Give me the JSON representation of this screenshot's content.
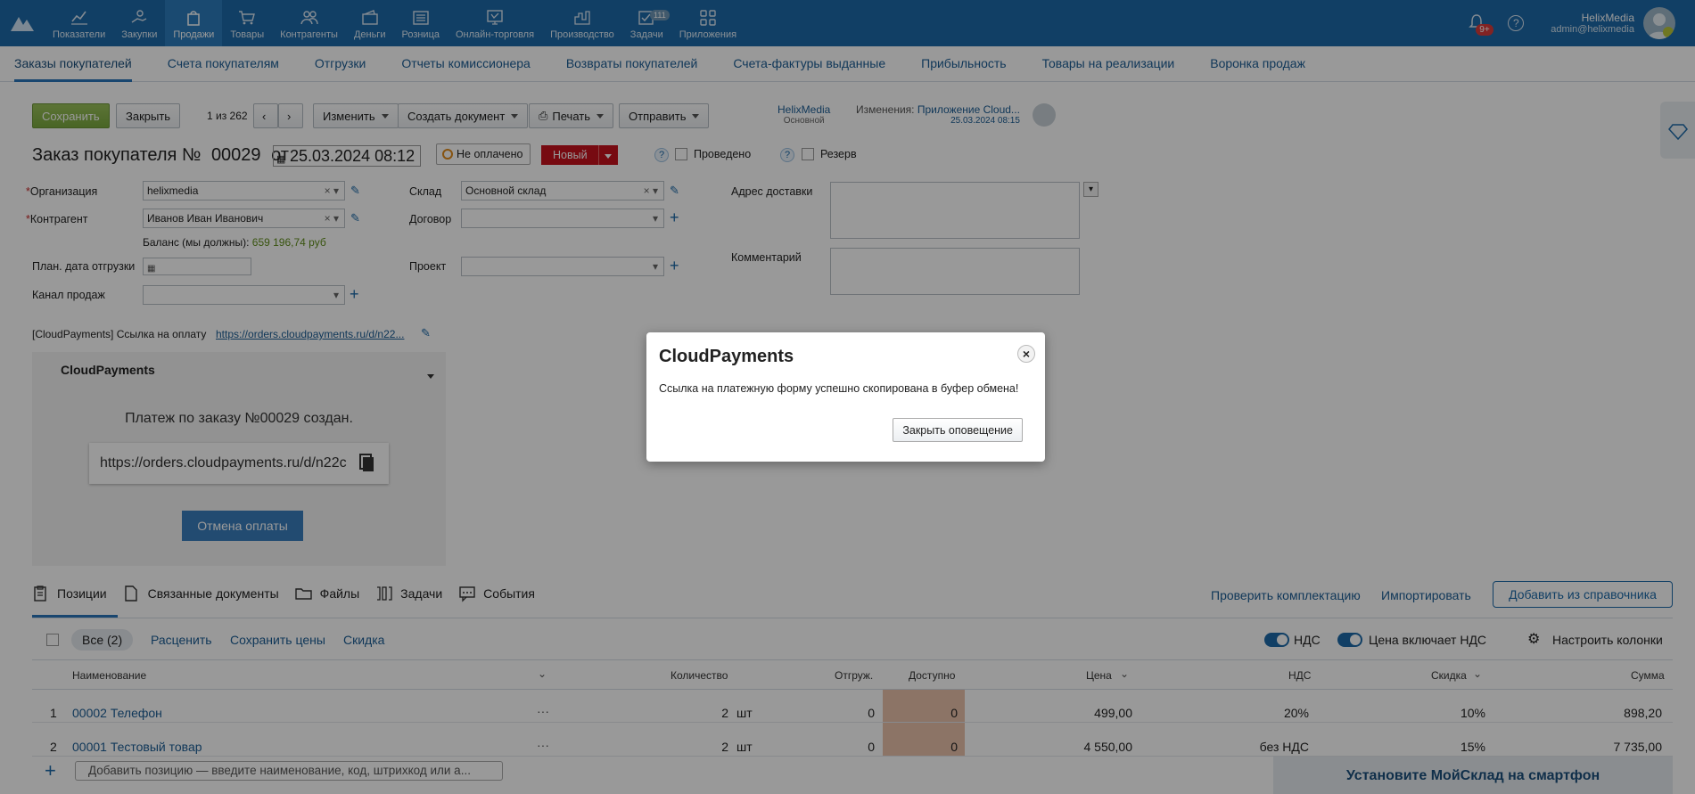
{
  "nav": {
    "items": [
      {
        "label": "Показатели",
        "icon": "chart-line-icon"
      },
      {
        "label": "Закупки",
        "icon": "hand-coins-icon"
      },
      {
        "label": "Продажи",
        "icon": "bag-icon"
      },
      {
        "label": "Товары",
        "icon": "cart-icon"
      },
      {
        "label": "Контрагенты",
        "icon": "people-icon"
      },
      {
        "label": "Деньги",
        "icon": "wallet-icon"
      },
      {
        "label": "Розница",
        "icon": "register-icon"
      },
      {
        "label": "Онлайн-торговля",
        "icon": "online-shop-icon"
      },
      {
        "label": "Производство",
        "icon": "factory-icon"
      },
      {
        "label": "Задачи",
        "icon": "tasks-icon",
        "badge": "111"
      },
      {
        "label": "Приложения",
        "icon": "apps-icon"
      }
    ],
    "notifications_badge": "9+",
    "help": "?",
    "user_name": "HelixMedia",
    "user_email": "admin@helixmedia"
  },
  "subtabs": [
    "Заказы покупателей",
    "Счета покупателям",
    "Отгрузки",
    "Отчеты комиссионера",
    "Возвраты покупателей",
    "Счета-фактуры выданные",
    "Прибыльность",
    "Товары на реализации",
    "Воронка продаж"
  ],
  "toolbar": {
    "save": "Сохранить",
    "close": "Закрыть",
    "pager": "1 из 262",
    "change": "Изменить",
    "create_doc": "Создать документ",
    "print": "Печать",
    "send": "Отправить",
    "org_owner": "HelixMedia",
    "org_owner_sub": "Основной",
    "changes_label": "Изменения:",
    "changes_app": "Приложение Cloud...",
    "changes_date": "25.03.2024 08:15"
  },
  "header": {
    "title": "Заказ покупателя №",
    "number": "00029",
    "from": "от",
    "date": "25.03.2024 08:12",
    "payment_status": "Не оплачено",
    "status": "Новый",
    "posted": "Проведено",
    "reserve": "Резерв"
  },
  "form": {
    "org_label": "Организация",
    "org_value": "helixmedia",
    "contractor_label": "Контрагент",
    "contractor_value": "Иванов Иван Иванович",
    "balance_label": "Баланс (мы должны):",
    "balance_value": "659 196,74 руб",
    "ship_date_label": "План. дата отгрузки",
    "channel_label": "Канал продаж",
    "warehouse_label": "Склад",
    "warehouse_value": "Основной склад",
    "contract_label": "Договор",
    "project_label": "Проект",
    "address_label": "Адрес доставки",
    "comment_label": "Комментарий",
    "cp_link_label": "[CloudPayments] Ссылка на оплату",
    "cp_link_value": "https://orders.cloudpayments.ru/d/n22..."
  },
  "widget": {
    "title": "CloudPayments",
    "message": "Платеж по заказу №00029 создан.",
    "url": "https://orders.cloudpayments.ru/d/n22c",
    "cancel": "Отмена оплаты"
  },
  "bottom_tabs": [
    {
      "label": "Позиции",
      "icon": "clipboard-icon"
    },
    {
      "label": "Связанные документы",
      "icon": "document-icon"
    },
    {
      "label": "Файлы",
      "icon": "folder-icon"
    },
    {
      "label": "Задачи",
      "icon": "tasks-board-icon"
    },
    {
      "label": "События",
      "icon": "chat-icon"
    }
  ],
  "actions": {
    "check": "Проверить комплектацию",
    "import": "Импортировать",
    "add_from_catalog": "Добавить из справочника"
  },
  "items_toolbar": {
    "all": "Все (2)",
    "reprice": "Расценить",
    "save_prices": "Сохранить цены",
    "discount": "Скидка",
    "vat": "НДС",
    "price_incl_vat": "Цена включает НДС",
    "columns": "Настроить колонки"
  },
  "table": {
    "headers": [
      "Наименование",
      "Количество",
      "Отгруж.",
      "Доступно",
      "Цена",
      "НДС",
      "Скидка",
      "Сумма"
    ],
    "rows": [
      {
        "n": "1",
        "name": "00002 Телефон",
        "qty": "2",
        "unit": "шт",
        "shipped": "0",
        "avail": "0",
        "price": "499,00",
        "vat": "20%",
        "disc": "10%",
        "sum": "898,20"
      },
      {
        "n": "2",
        "name": "00001 Тестовый товар",
        "qty": "2",
        "unit": "шт",
        "shipped": "0",
        "avail": "0",
        "price": "4 550,00",
        "vat": "без НДС",
        "disc": "15%",
        "sum": "7 735,00"
      }
    ],
    "add_placeholder": "Добавить позицию — введите наименование, код, штрихкод или а..."
  },
  "promo": "Установите МойСклад на смартфон",
  "modal": {
    "title": "CloudPayments",
    "message": "Ссылка на платежную форму успешно скопирована в буфер обмена!",
    "close_button": "Закрыть оповещение",
    "close_icon": "×"
  }
}
